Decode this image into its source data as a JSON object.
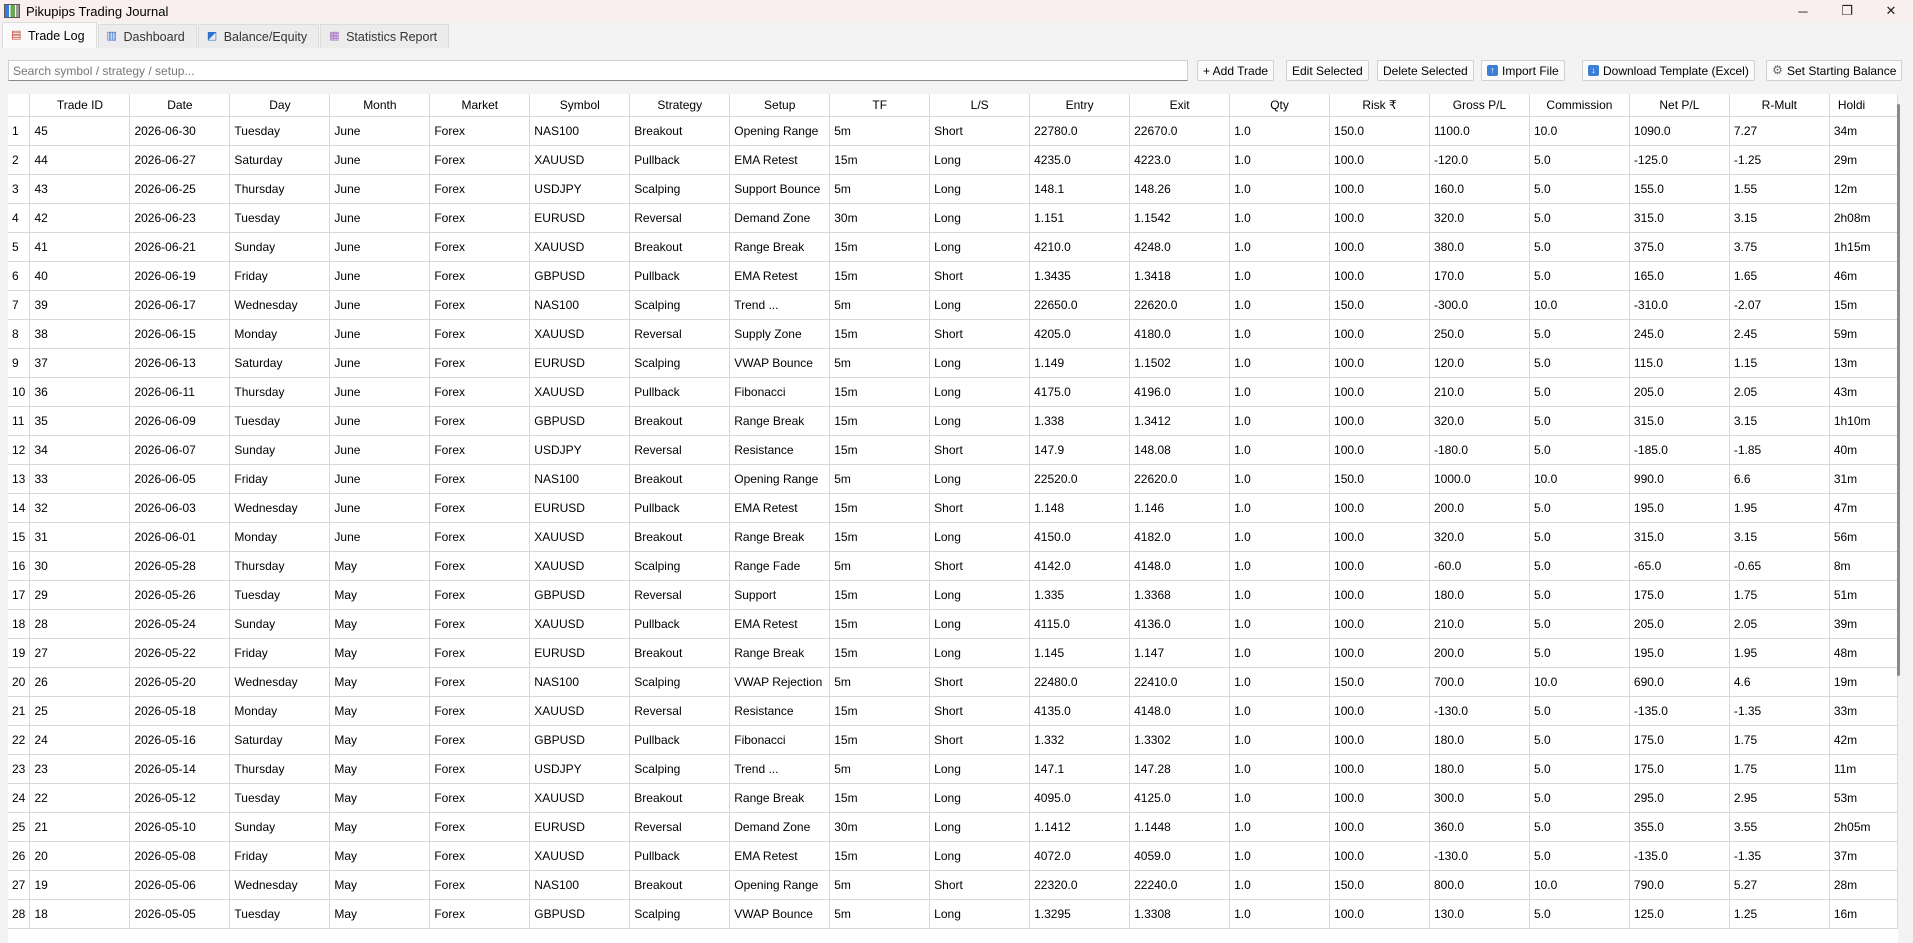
{
  "window": {
    "title": "Pikupips Trading Journal",
    "minimize": "─",
    "maximize": "❐",
    "close": "✕"
  },
  "tabs": [
    {
      "label": "Trade Log",
      "icon": "ledger-icon"
    },
    {
      "label": "Dashboard",
      "icon": "bar-chart-icon"
    },
    {
      "label": "Balance/Equity",
      "icon": "line-chart-icon"
    },
    {
      "label": "Statistics Report",
      "icon": "report-icon"
    }
  ],
  "toolbar": {
    "search_placeholder": "Search symbol / strategy / setup...",
    "add": "+ Add Trade",
    "edit": "Edit Selected",
    "delete": "Delete Selected",
    "import": "Import File",
    "download": "Download Template (Excel)",
    "balance": "Set Starting Balance"
  },
  "columns": [
    "Trade ID",
    "Date",
    "Day",
    "Month",
    "Market",
    "Symbol",
    "Strategy",
    "Setup",
    "TF",
    "L/S",
    "Entry",
    "Exit",
    "Qty",
    "Risk ₹",
    "Gross P/L",
    "Commission",
    "Net P/L",
    "R-Mult",
    "Holdi"
  ],
  "rows": [
    [
      "1",
      "45",
      "2026-06-30",
      "Tuesday",
      "June",
      "Forex",
      "NAS100",
      "Breakout",
      "Opening Range",
      "5m",
      "Short",
      "22780.0",
      "22670.0",
      "1.0",
      "150.0",
      "1100.0",
      "10.0",
      "1090.0",
      "7.27",
      "34m"
    ],
    [
      "2",
      "44",
      "2026-06-27",
      "Saturday",
      "June",
      "Forex",
      "XAUUSD",
      "Pullback",
      "EMA Retest",
      "15m",
      "Long",
      "4235.0",
      "4223.0",
      "1.0",
      "100.0",
      "-120.0",
      "5.0",
      "-125.0",
      "-1.25",
      "29m"
    ],
    [
      "3",
      "43",
      "2026-06-25",
      "Thursday",
      "June",
      "Forex",
      "USDJPY",
      "Scalping",
      "Support Bounce",
      "5m",
      "Long",
      "148.1",
      "148.26",
      "1.0",
      "100.0",
      "160.0",
      "5.0",
      "155.0",
      "1.55",
      "12m"
    ],
    [
      "4",
      "42",
      "2026-06-23",
      "Tuesday",
      "June",
      "Forex",
      "EURUSD",
      "Reversal",
      "Demand Zone",
      "30m",
      "Long",
      "1.151",
      "1.1542",
      "1.0",
      "100.0",
      "320.0",
      "5.0",
      "315.0",
      "3.15",
      "2h08m"
    ],
    [
      "5",
      "41",
      "2026-06-21",
      "Sunday",
      "June",
      "Forex",
      "XAUUSD",
      "Breakout",
      "Range Break",
      "15m",
      "Long",
      "4210.0",
      "4248.0",
      "1.0",
      "100.0",
      "380.0",
      "5.0",
      "375.0",
      "3.75",
      "1h15m"
    ],
    [
      "6",
      "40",
      "2026-06-19",
      "Friday",
      "June",
      "Forex",
      "GBPUSD",
      "Pullback",
      "EMA Retest",
      "15m",
      "Short",
      "1.3435",
      "1.3418",
      "1.0",
      "100.0",
      "170.0",
      "5.0",
      "165.0",
      "1.65",
      "46m"
    ],
    [
      "7",
      "39",
      "2026-06-17",
      "Wednesday",
      "June",
      "Forex",
      "NAS100",
      "Scalping",
      "Trend ...",
      "5m",
      "Long",
      "22650.0",
      "22620.0",
      "1.0",
      "150.0",
      "-300.0",
      "10.0",
      "-310.0",
      "-2.07",
      "15m"
    ],
    [
      "8",
      "38",
      "2026-06-15",
      "Monday",
      "June",
      "Forex",
      "XAUUSD",
      "Reversal",
      "Supply Zone",
      "15m",
      "Short",
      "4205.0",
      "4180.0",
      "1.0",
      "100.0",
      "250.0",
      "5.0",
      "245.0",
      "2.45",
      "59m"
    ],
    [
      "9",
      "37",
      "2026-06-13",
      "Saturday",
      "June",
      "Forex",
      "EURUSD",
      "Scalping",
      "VWAP Bounce",
      "5m",
      "Long",
      "1.149",
      "1.1502",
      "1.0",
      "100.0",
      "120.0",
      "5.0",
      "115.0",
      "1.15",
      "13m"
    ],
    [
      "10",
      "36",
      "2026-06-11",
      "Thursday",
      "June",
      "Forex",
      "XAUUSD",
      "Pullback",
      "Fibonacci",
      "15m",
      "Long",
      "4175.0",
      "4196.0",
      "1.0",
      "100.0",
      "210.0",
      "5.0",
      "205.0",
      "2.05",
      "43m"
    ],
    [
      "11",
      "35",
      "2026-06-09",
      "Tuesday",
      "June",
      "Forex",
      "GBPUSD",
      "Breakout",
      "Range Break",
      "15m",
      "Long",
      "1.338",
      "1.3412",
      "1.0",
      "100.0",
      "320.0",
      "5.0",
      "315.0",
      "3.15",
      "1h10m"
    ],
    [
      "12",
      "34",
      "2026-06-07",
      "Sunday",
      "June",
      "Forex",
      "USDJPY",
      "Reversal",
      "Resistance",
      "15m",
      "Short",
      "147.9",
      "148.08",
      "1.0",
      "100.0",
      "-180.0",
      "5.0",
      "-185.0",
      "-1.85",
      "40m"
    ],
    [
      "13",
      "33",
      "2026-06-05",
      "Friday",
      "June",
      "Forex",
      "NAS100",
      "Breakout",
      "Opening Range",
      "5m",
      "Long",
      "22520.0",
      "22620.0",
      "1.0",
      "150.0",
      "1000.0",
      "10.0",
      "990.0",
      "6.6",
      "31m"
    ],
    [
      "14",
      "32",
      "2026-06-03",
      "Wednesday",
      "June",
      "Forex",
      "EURUSD",
      "Pullback",
      "EMA Retest",
      "15m",
      "Short",
      "1.148",
      "1.146",
      "1.0",
      "100.0",
      "200.0",
      "5.0",
      "195.0",
      "1.95",
      "47m"
    ],
    [
      "15",
      "31",
      "2026-06-01",
      "Monday",
      "June",
      "Forex",
      "XAUUSD",
      "Breakout",
      "Range Break",
      "15m",
      "Long",
      "4150.0",
      "4182.0",
      "1.0",
      "100.0",
      "320.0",
      "5.0",
      "315.0",
      "3.15",
      "56m"
    ],
    [
      "16",
      "30",
      "2026-05-28",
      "Thursday",
      "May",
      "Forex",
      "XAUUSD",
      "Scalping",
      "Range Fade",
      "5m",
      "Short",
      "4142.0",
      "4148.0",
      "1.0",
      "100.0",
      "-60.0",
      "5.0",
      "-65.0",
      "-0.65",
      "8m"
    ],
    [
      "17",
      "29",
      "2026-05-26",
      "Tuesday",
      "May",
      "Forex",
      "GBPUSD",
      "Reversal",
      "Support",
      "15m",
      "Long",
      "1.335",
      "1.3368",
      "1.0",
      "100.0",
      "180.0",
      "5.0",
      "175.0",
      "1.75",
      "51m"
    ],
    [
      "18",
      "28",
      "2026-05-24",
      "Sunday",
      "May",
      "Forex",
      "XAUUSD",
      "Pullback",
      "EMA Retest",
      "15m",
      "Long",
      "4115.0",
      "4136.0",
      "1.0",
      "100.0",
      "210.0",
      "5.0",
      "205.0",
      "2.05",
      "39m"
    ],
    [
      "19",
      "27",
      "2026-05-22",
      "Friday",
      "May",
      "Forex",
      "EURUSD",
      "Breakout",
      "Range Break",
      "15m",
      "Long",
      "1.145",
      "1.147",
      "1.0",
      "100.0",
      "200.0",
      "5.0",
      "195.0",
      "1.95",
      "48m"
    ],
    [
      "20",
      "26",
      "2026-05-20",
      "Wednesday",
      "May",
      "Forex",
      "NAS100",
      "Scalping",
      "VWAP Rejection",
      "5m",
      "Short",
      "22480.0",
      "22410.0",
      "1.0",
      "150.0",
      "700.0",
      "10.0",
      "690.0",
      "4.6",
      "19m"
    ],
    [
      "21",
      "25",
      "2026-05-18",
      "Monday",
      "May",
      "Forex",
      "XAUUSD",
      "Reversal",
      "Resistance",
      "15m",
      "Short",
      "4135.0",
      "4148.0",
      "1.0",
      "100.0",
      "-130.0",
      "5.0",
      "-135.0",
      "-1.35",
      "33m"
    ],
    [
      "22",
      "24",
      "2026-05-16",
      "Saturday",
      "May",
      "Forex",
      "GBPUSD",
      "Pullback",
      "Fibonacci",
      "15m",
      "Short",
      "1.332",
      "1.3302",
      "1.0",
      "100.0",
      "180.0",
      "5.0",
      "175.0",
      "1.75",
      "42m"
    ],
    [
      "23",
      "23",
      "2026-05-14",
      "Thursday",
      "May",
      "Forex",
      "USDJPY",
      "Scalping",
      "Trend ...",
      "5m",
      "Long",
      "147.1",
      "147.28",
      "1.0",
      "100.0",
      "180.0",
      "5.0",
      "175.0",
      "1.75",
      "11m"
    ],
    [
      "24",
      "22",
      "2026-05-12",
      "Tuesday",
      "May",
      "Forex",
      "XAUUSD",
      "Breakout",
      "Range Break",
      "15m",
      "Long",
      "4095.0",
      "4125.0",
      "1.0",
      "100.0",
      "300.0",
      "5.0",
      "295.0",
      "2.95",
      "53m"
    ],
    [
      "25",
      "21",
      "2026-05-10",
      "Sunday",
      "May",
      "Forex",
      "EURUSD",
      "Reversal",
      "Demand Zone",
      "30m",
      "Long",
      "1.1412",
      "1.1448",
      "1.0",
      "100.0",
      "360.0",
      "5.0",
      "355.0",
      "3.55",
      "2h05m"
    ],
    [
      "26",
      "20",
      "2026-05-08",
      "Friday",
      "May",
      "Forex",
      "XAUUSD",
      "Pullback",
      "EMA Retest",
      "15m",
      "Long",
      "4072.0",
      "4059.0",
      "1.0",
      "100.0",
      "-130.0",
      "5.0",
      "-135.0",
      "-1.35",
      "37m"
    ],
    [
      "27",
      "19",
      "2026-05-06",
      "Wednesday",
      "May",
      "Forex",
      "NAS100",
      "Breakout",
      "Opening Range",
      "5m",
      "Short",
      "22320.0",
      "22240.0",
      "1.0",
      "150.0",
      "800.0",
      "10.0",
      "790.0",
      "5.27",
      "28m"
    ],
    [
      "28",
      "18",
      "2026-05-05",
      "Tuesday",
      "May",
      "Forex",
      "GBPUSD",
      "Scalping",
      "VWAP Bounce",
      "5m",
      "Long",
      "1.3295",
      "1.3308",
      "1.0",
      "100.0",
      "130.0",
      "5.0",
      "125.0",
      "1.25",
      "16m"
    ]
  ]
}
